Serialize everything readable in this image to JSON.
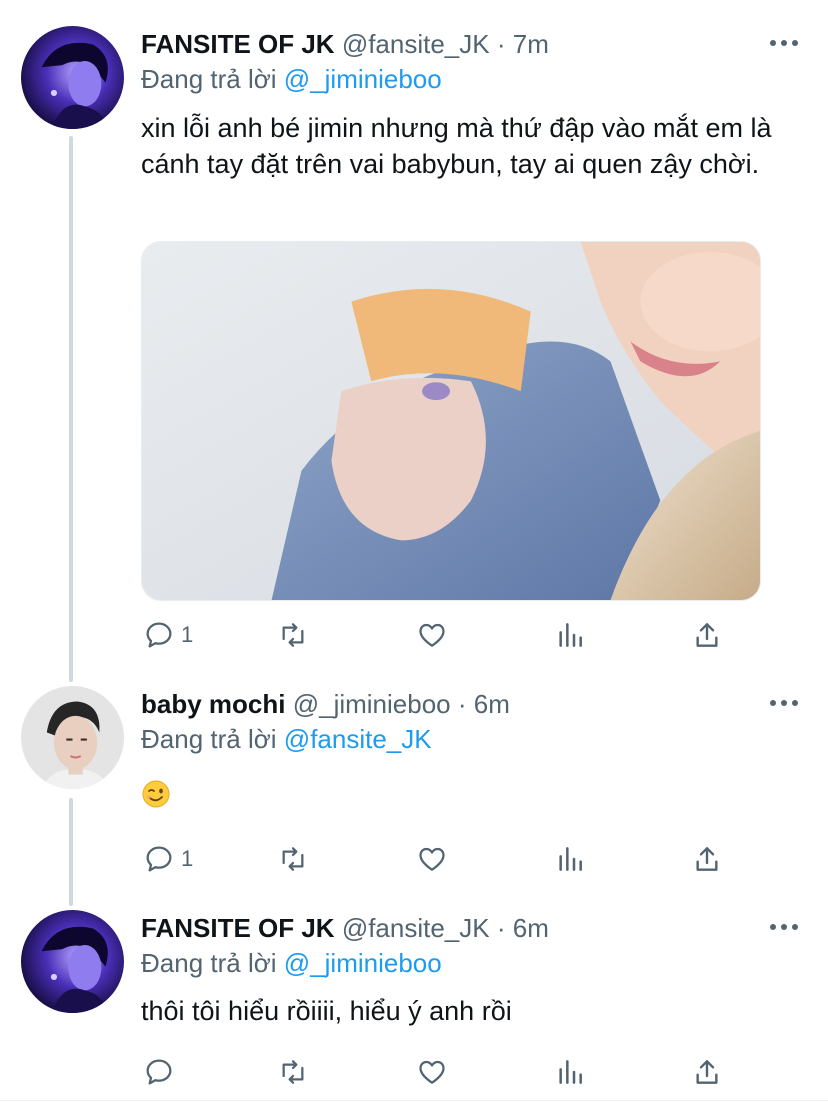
{
  "tweets": [
    {
      "author_name": "FANSITE OF JK",
      "handle": "@fansite_JK",
      "time": "7m",
      "reply_prefix": "Đang trả lời",
      "reply_to": "@_jiminieboo",
      "text": "xin lỗi anh bé jimin nhưng mà thứ đập vào mắt em là cánh tay đặt trên vai babybun, tay ai quen zậy chời.",
      "reply_count": "1",
      "has_media": true
    },
    {
      "author_name": "baby mochi",
      "handle": "@_jiminieboo",
      "time": "6m",
      "reply_prefix": "Đang trả lời",
      "reply_to": "@fansite_JK",
      "text": "😉",
      "reply_count": "1"
    },
    {
      "author_name": "FANSITE OF JK",
      "handle": "@fansite_JK",
      "time": "6m",
      "reply_prefix": "Đang trả lời",
      "reply_to": "@_jiminieboo",
      "text": "thôi tôi hiểu rồiiii, hiểu ý anh rồi",
      "reply_count": ""
    }
  ],
  "separator": " · ",
  "icons": {
    "reply": "reply-icon",
    "retweet": "retweet-icon",
    "like": "heart-icon",
    "stats": "stats-icon",
    "share": "share-icon",
    "more": "more-icon"
  },
  "colors": {
    "link": "#1d9bf0",
    "secondary": "#536471",
    "thread_line": "#cfd9de"
  }
}
